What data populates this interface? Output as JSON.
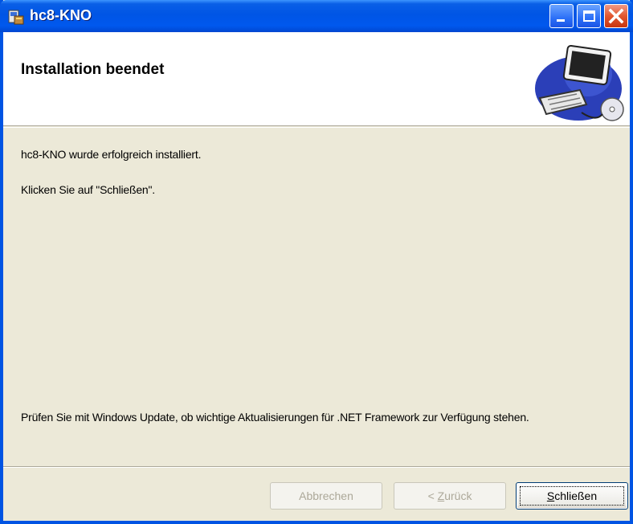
{
  "window": {
    "title": "hc8-KNO"
  },
  "banner": {
    "title": "Installation beendet"
  },
  "body": {
    "line1": "hc8-KNO wurde erfolgreich installiert.",
    "line2": "Klicken Sie auf \"Schließen\".",
    "update_note": "Prüfen Sie mit Windows Update, ob wichtige Aktualisierungen für .NET Framework zur Verfügung stehen."
  },
  "buttons": {
    "cancel": "Abbrechen",
    "back_prefix": "< ",
    "back_accel": "Z",
    "back_rest": "urück",
    "close_accel": "S",
    "close_rest": "chließen"
  },
  "icons": {
    "app": "installer-icon",
    "banner": "computer-cd-icon"
  },
  "colors": {
    "titlebar": "#0055e5",
    "dialog_bg": "#ece9d8",
    "close_button": "#e2572f"
  }
}
